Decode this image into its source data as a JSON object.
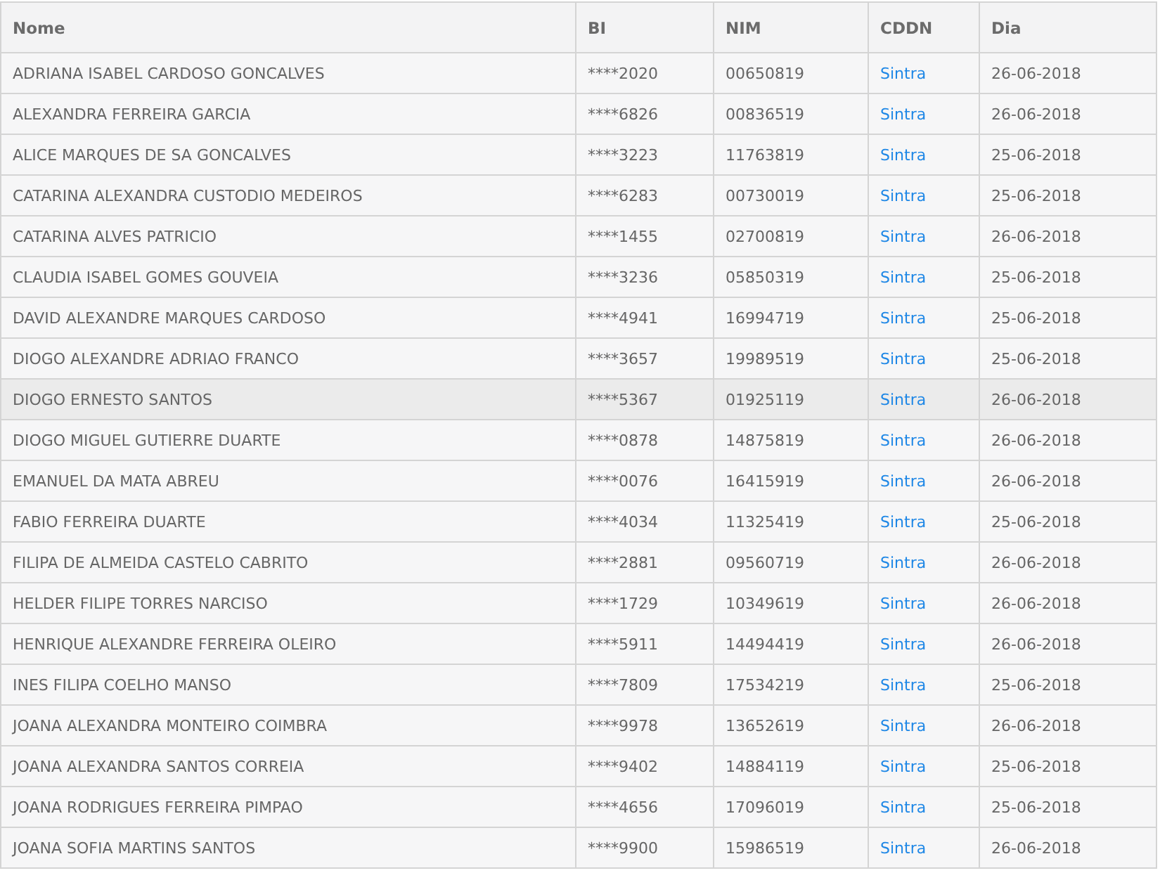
{
  "table": {
    "columns": [
      "Nome",
      "BI",
      "NIM",
      "CDDN",
      "Dia"
    ],
    "rows": [
      {
        "name": "ADRIANA ISABEL CARDOSO GONCALVES",
        "bi": "****2020",
        "nim": "00650819",
        "cddn": "Sintra",
        "dia": "26-06-2018",
        "highlighted": false
      },
      {
        "name": "ALEXANDRA FERREIRA GARCIA",
        "bi": "****6826",
        "nim": "00836519",
        "cddn": "Sintra",
        "dia": "26-06-2018",
        "highlighted": false
      },
      {
        "name": "ALICE MARQUES DE SA GONCALVES",
        "bi": "****3223",
        "nim": "11763819",
        "cddn": "Sintra",
        "dia": "25-06-2018",
        "highlighted": false
      },
      {
        "name": "CATARINA ALEXANDRA CUSTODIO MEDEIROS",
        "bi": "****6283",
        "nim": "00730019",
        "cddn": "Sintra",
        "dia": "25-06-2018",
        "highlighted": false
      },
      {
        "name": "CATARINA ALVES PATRICIO",
        "bi": "****1455",
        "nim": "02700819",
        "cddn": "Sintra",
        "dia": "26-06-2018",
        "highlighted": false
      },
      {
        "name": "CLAUDIA ISABEL GOMES GOUVEIA",
        "bi": "****3236",
        "nim": "05850319",
        "cddn": "Sintra",
        "dia": "25-06-2018",
        "highlighted": false
      },
      {
        "name": "DAVID ALEXANDRE MARQUES CARDOSO",
        "bi": "****4941",
        "nim": "16994719",
        "cddn": "Sintra",
        "dia": "25-06-2018",
        "highlighted": false
      },
      {
        "name": "DIOGO ALEXANDRE ADRIAO FRANCO",
        "bi": "****3657",
        "nim": "19989519",
        "cddn": "Sintra",
        "dia": "25-06-2018",
        "highlighted": false
      },
      {
        "name": "DIOGO ERNESTO SANTOS",
        "bi": "****5367",
        "nim": "01925119",
        "cddn": "Sintra",
        "dia": "26-06-2018",
        "highlighted": true
      },
      {
        "name": "DIOGO MIGUEL GUTIERRE DUARTE",
        "bi": "****0878",
        "nim": "14875819",
        "cddn": "Sintra",
        "dia": "26-06-2018",
        "highlighted": false
      },
      {
        "name": "EMANUEL DA MATA ABREU",
        "bi": "****0076",
        "nim": "16415919",
        "cddn": "Sintra",
        "dia": "26-06-2018",
        "highlighted": false
      },
      {
        "name": "FABIO FERREIRA DUARTE",
        "bi": "****4034",
        "nim": "11325419",
        "cddn": "Sintra",
        "dia": "25-06-2018",
        "highlighted": false
      },
      {
        "name": "FILIPA DE ALMEIDA CASTELO CABRITO",
        "bi": "****2881",
        "nim": "09560719",
        "cddn": "Sintra",
        "dia": "26-06-2018",
        "highlighted": false
      },
      {
        "name": "HELDER FILIPE TORRES NARCISO",
        "bi": "****1729",
        "nim": "10349619",
        "cddn": "Sintra",
        "dia": "26-06-2018",
        "highlighted": false
      },
      {
        "name": "HENRIQUE ALEXANDRE FERREIRA OLEIRO",
        "bi": "****5911",
        "nim": "14494419",
        "cddn": "Sintra",
        "dia": "26-06-2018",
        "highlighted": false
      },
      {
        "name": "INES FILIPA COELHO MANSO",
        "bi": "****7809",
        "nim": "17534219",
        "cddn": "Sintra",
        "dia": "25-06-2018",
        "highlighted": false
      },
      {
        "name": "JOANA ALEXANDRA MONTEIRO COIMBRA",
        "bi": "****9978",
        "nim": "13652619",
        "cddn": "Sintra",
        "dia": "26-06-2018",
        "highlighted": false
      },
      {
        "name": "JOANA ALEXANDRA SANTOS CORREIA",
        "bi": "****9402",
        "nim": "14884119",
        "cddn": "Sintra",
        "dia": "25-06-2018",
        "highlighted": false
      },
      {
        "name": "JOANA RODRIGUES FERREIRA PIMPAO",
        "bi": "****4656",
        "nim": "17096019",
        "cddn": "Sintra",
        "dia": "25-06-2018",
        "highlighted": false
      },
      {
        "name": "JOANA SOFIA MARTINS SANTOS",
        "bi": "****9900",
        "nim": "15986519",
        "cddn": "Sintra",
        "dia": "26-06-2018",
        "highlighted": false
      }
    ]
  }
}
